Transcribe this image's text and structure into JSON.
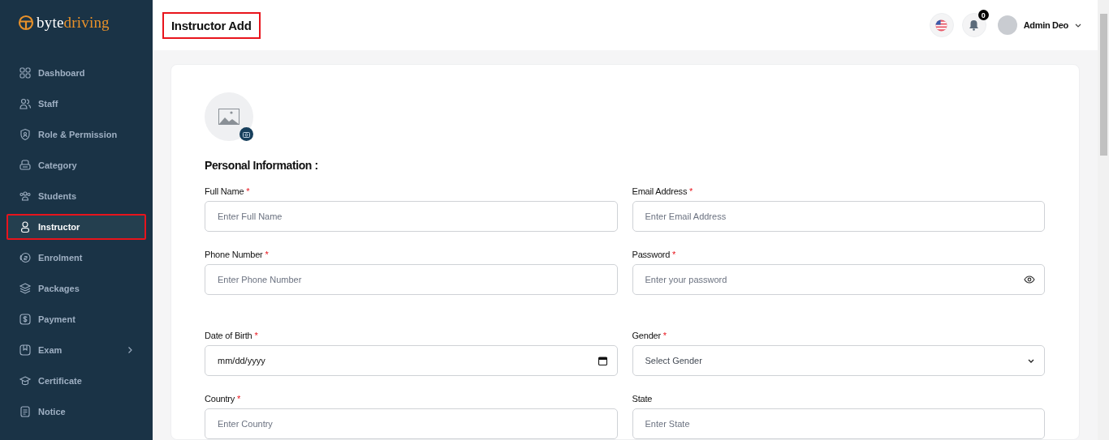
{
  "logo": {
    "part_1": "byte",
    "part_2": "driving"
  },
  "sidebar": {
    "items": [
      {
        "label": "Dashboard",
        "selected": false,
        "highlighted": false
      },
      {
        "label": "Staff",
        "selected": false,
        "highlighted": false
      },
      {
        "label": "Role & Permission",
        "selected": false,
        "highlighted": false
      },
      {
        "label": "Category",
        "selected": false,
        "highlighted": false
      },
      {
        "label": "Students",
        "selected": false,
        "highlighted": false
      },
      {
        "label": "Instructor",
        "selected": true,
        "highlighted": true
      },
      {
        "label": "Enrolment",
        "selected": false,
        "highlighted": false
      },
      {
        "label": "Packages",
        "selected": false,
        "highlighted": false
      },
      {
        "label": "Payment",
        "selected": false,
        "highlighted": false
      },
      {
        "label": "Exam",
        "selected": false,
        "highlighted": false,
        "expandable": true
      },
      {
        "label": "Certificate",
        "selected": false,
        "highlighted": false
      },
      {
        "label": "Notice",
        "selected": false,
        "highlighted": false
      }
    ]
  },
  "header": {
    "title": "Instructor Add",
    "title_highlighted": true,
    "notification_count": "0",
    "user_name": "Admin Deo"
  },
  "form": {
    "section_title": "Personal Information :",
    "fields": [
      {
        "label": "Full Name",
        "mark": "*",
        "kind": "text",
        "placeholder": "Enter Full Name"
      },
      {
        "label": "Email Address",
        "mark": "*",
        "kind": "text",
        "placeholder": "Enter Email Address"
      },
      {
        "label": "Phone Number",
        "mark": "*",
        "kind": "text",
        "placeholder": "Enter Phone Number"
      },
      {
        "label": "Password",
        "mark": "*",
        "kind": "password",
        "placeholder": "Enter your password"
      },
      {
        "label": "Date of Birth",
        "mark": "*",
        "kind": "date",
        "value": "mm/dd/yyyy"
      },
      {
        "label": "Gender",
        "mark": "*",
        "kind": "select",
        "value": "Select Gender"
      },
      {
        "label": "Country",
        "mark": "*",
        "kind": "text",
        "placeholder": "Enter Country"
      },
      {
        "label": "State",
        "kind": "text",
        "placeholder": "Enter State"
      }
    ]
  }
}
